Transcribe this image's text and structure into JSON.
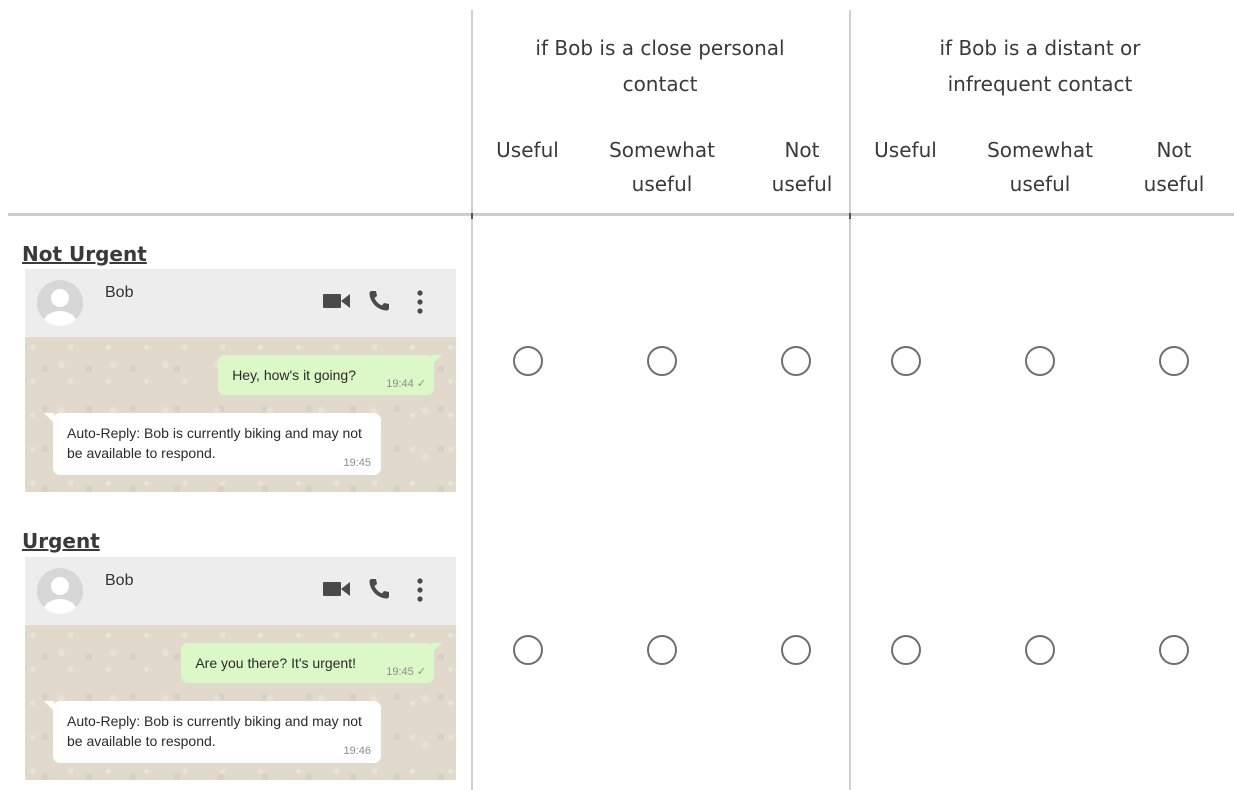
{
  "header": {
    "group_close": "if Bob is a close personal contact",
    "group_distant": "if Bob is a distant or infrequent contact",
    "columns": [
      {
        "label": "Useful"
      },
      {
        "label": "Somewhat useful"
      },
      {
        "label": "Not useful"
      },
      {
        "label": "Useful"
      },
      {
        "label": "Somewhat useful"
      },
      {
        "label": "Not useful"
      }
    ]
  },
  "rows": [
    {
      "label": "Not Urgent",
      "chat": {
        "contact": "Bob",
        "outgoing": {
          "text": "Hey, how's it going?",
          "time": "19:44",
          "status": "✓"
        },
        "incoming": {
          "text": "Auto-Reply: Bob is currently biking and may not be available to respond.",
          "time": "19:45"
        }
      }
    },
    {
      "label": "Urgent",
      "chat": {
        "contact": "Bob",
        "outgoing": {
          "text": "Are you there? It's urgent!",
          "time": "19:45",
          "status": "✓"
        },
        "incoming": {
          "text": "Auto-Reply: Bob is currently biking and may not be available to respond.",
          "time": "19:46"
        }
      }
    }
  ],
  "icons": {
    "video": "video-camera-icon",
    "call": "phone-icon",
    "menu": "more-vertical-icon",
    "avatar": "default-avatar-icon"
  },
  "colors": {
    "outgoing_bubble": "#dcf8c6",
    "incoming_bubble": "#ffffff",
    "chat_background": "#e2d9cd",
    "chat_header": "#ededed"
  }
}
